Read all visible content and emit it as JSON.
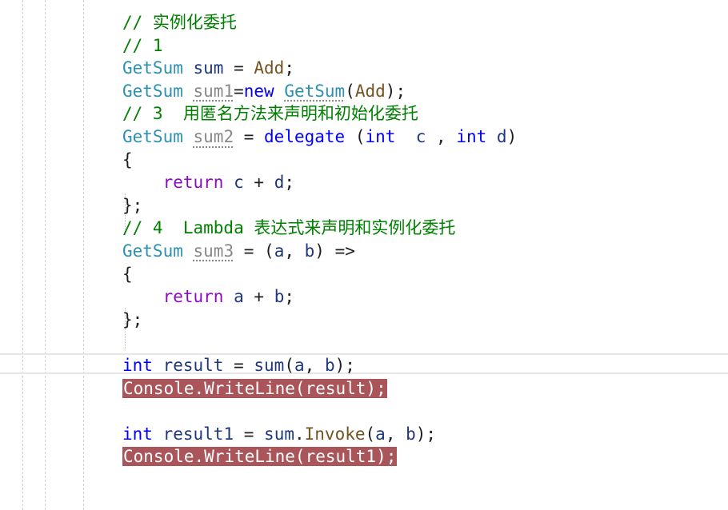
{
  "lines": {
    "l1": {
      "comment": "// 实例化委托"
    },
    "l2": {
      "comment": "// 1"
    },
    "l3": {
      "type": "GetSum",
      "var": "sum",
      "eq": " = ",
      "method": "Add",
      "end": ";"
    },
    "l4": {
      "type": "GetSum",
      "var": "sum1",
      "eq": "=",
      "kw": "new",
      "type2": "GetSum",
      "open": "(",
      "method": "Add",
      "close": ");"
    },
    "l5": {
      "comment": "// 3  用匿名方法来声明和初始化委托"
    },
    "l6": {
      "type": "GetSum",
      "var": "sum2",
      "eq": " = ",
      "kw": "delegate",
      "open": " (",
      "int1": "int",
      "p1": "c",
      "sep": " , ",
      "int2": "int",
      "p2": "d",
      "close": ")"
    },
    "l7": {
      "brace": "{"
    },
    "l8": {
      "kw": "return",
      "a": "c",
      "op": " + ",
      "b": "d",
      "end": ";"
    },
    "l9": {
      "brace": "}",
      "end": ";"
    },
    "l10": {
      "comment": "// 4  Lambda 表达式来声明和实例化委托"
    },
    "l11": {
      "type": "GetSum",
      "var": "sum3",
      "eq": " = ",
      "open": "(",
      "a": "a",
      "sep": ", ",
      "b": "b",
      "close": ")",
      "arrow": " =>"
    },
    "l12": {
      "brace": "{"
    },
    "l13": {
      "kw": "return",
      "a": "a",
      "op": " + ",
      "b": "b",
      "end": ";"
    },
    "l14": {
      "brace": "}",
      "end": ";"
    },
    "l15": {
      "text": ""
    },
    "l16": {
      "kw": "int",
      "var": "result",
      "eq": " = ",
      "call": "sum",
      "open": "(",
      "a": "a",
      "sep": ", ",
      "b": "b",
      "close": ");"
    },
    "l17": {
      "stmt": "Console.WriteLine(result);"
    },
    "l18": {
      "text": ""
    },
    "l19": {
      "kw": "int",
      "var": "result1",
      "eq": " = ",
      "call": "sum",
      "dot": ".",
      "method": "Invoke",
      "open": "(",
      "a": "a",
      "sep": ", ",
      "b": "b",
      "close": ");"
    },
    "l20": {
      "stmt": "Console.WriteLine(result1);"
    }
  }
}
